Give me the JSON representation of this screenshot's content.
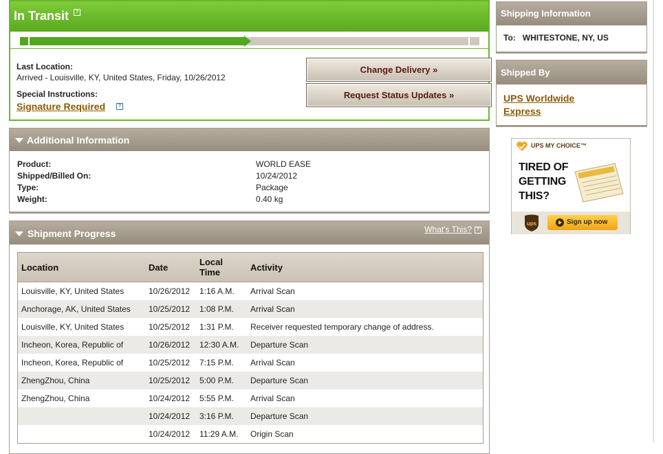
{
  "status": {
    "title": "In Transit",
    "help": "?",
    "progress_fraction": 0.5,
    "last_location_label": "Last Location:",
    "last_location_value": "Arrived - Louisville, KY, United States, Friday, 10/26/2012",
    "special_instructions_label": "Special Instructions:",
    "signature_link": "Signature Required",
    "change_delivery": "Change Delivery »",
    "request_updates": "Request Status Updates »"
  },
  "additional": {
    "title": "Additional Information",
    "fields": [
      {
        "label": "Product:",
        "value": "WORLD EASE"
      },
      {
        "label": "Shipped/Billed On:",
        "value": "10/24/2012"
      },
      {
        "label": "Type:",
        "value": "Package"
      },
      {
        "label": "Weight:",
        "value": "0.40 kg"
      }
    ]
  },
  "progress": {
    "title": "Shipment Progress",
    "whats_this": "What's This?",
    "columns": [
      "Location",
      "Date",
      "Local Time",
      "Activity"
    ],
    "col_time_line1": "Local",
    "col_time_line2": "Time",
    "rows": [
      {
        "location": "Louisville, KY, United States",
        "date": "10/26/2012",
        "time": "1:16 A.M.",
        "activity": "Arrival Scan"
      },
      {
        "location": "Anchorage, AK, United States",
        "date": "10/25/2012",
        "time": "1:08 P.M.",
        "activity": "Arrival Scan"
      },
      {
        "location": "Louisville, KY, United States",
        "date": "10/25/2012",
        "time": "1:31 P.M.",
        "activity": "Receiver requested temporary change of address."
      },
      {
        "location": "Incheon, Korea, Republic of",
        "date": "10/26/2012",
        "time": "12:30 A.M.",
        "activity": "Departure Scan"
      },
      {
        "location": "Incheon, Korea, Republic of",
        "date": "10/25/2012",
        "time": "7:15 P.M.",
        "activity": "Arrival Scan"
      },
      {
        "location": "ZhengZhou, China",
        "date": "10/25/2012",
        "time": "5:00 P.M.",
        "activity": "Departure Scan"
      },
      {
        "location": "ZhengZhou, China",
        "date": "10/24/2012",
        "time": "5:55 P.M.",
        "activity": "Arrival Scan"
      },
      {
        "location": "",
        "date": "10/24/2012",
        "time": "3:16 P.M.",
        "activity": "Departure Scan"
      },
      {
        "location": "",
        "date": "10/24/2012",
        "time": "11:29 A.M.",
        "activity": "Origin Scan"
      }
    ]
  },
  "sidebar": {
    "shipping_title": "Shipping Information",
    "to_label": "To:",
    "to_value": "WHITESTONE, NY, US",
    "shipped_by_title": "Shipped By",
    "carrier_link": "UPS Worldwide Express"
  },
  "ad": {
    "brand": "UPS MY CHOICE™",
    "line1": "TIRED OF",
    "line2": "GETTING",
    "line3": "THIS?",
    "logo": "ups",
    "signup": "Sign up now"
  }
}
